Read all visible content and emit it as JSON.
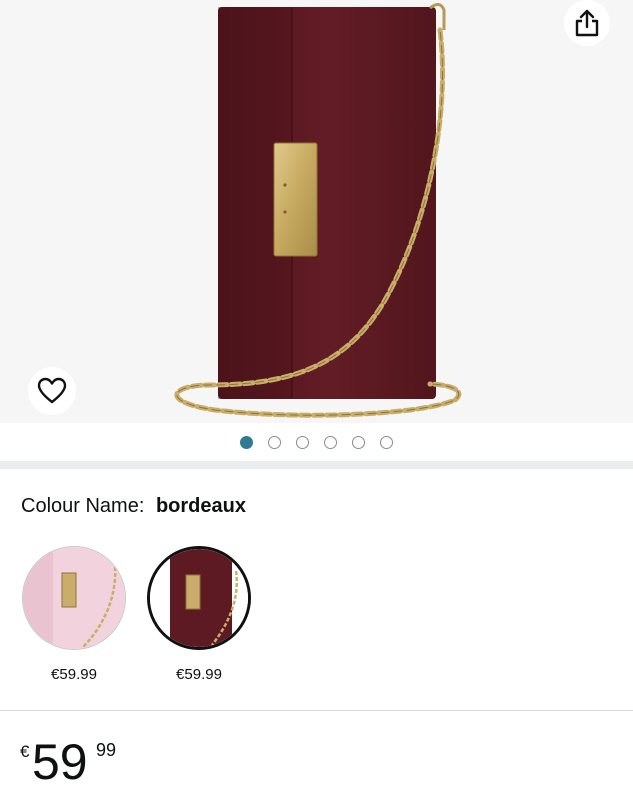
{
  "product": {
    "image_dots": 6,
    "active_dot": 0,
    "colour_label": "Colour Name:",
    "colour_value": "bordeaux",
    "variants": [
      {
        "name": "pink",
        "price": "€59.99",
        "selected": false
      },
      {
        "name": "bordeaux",
        "price": "€59.99",
        "selected": true
      }
    ],
    "price": {
      "symbol": "€",
      "whole": "59",
      "fraction": "99"
    }
  },
  "colors": {
    "bordeaux": "#5e1a22",
    "pink": "#f2d3dd",
    "gold": "#c9ae6b",
    "accent_dot": "#2f7c91"
  },
  "icons": {
    "share": "share-icon",
    "favorite": "heart-icon"
  }
}
